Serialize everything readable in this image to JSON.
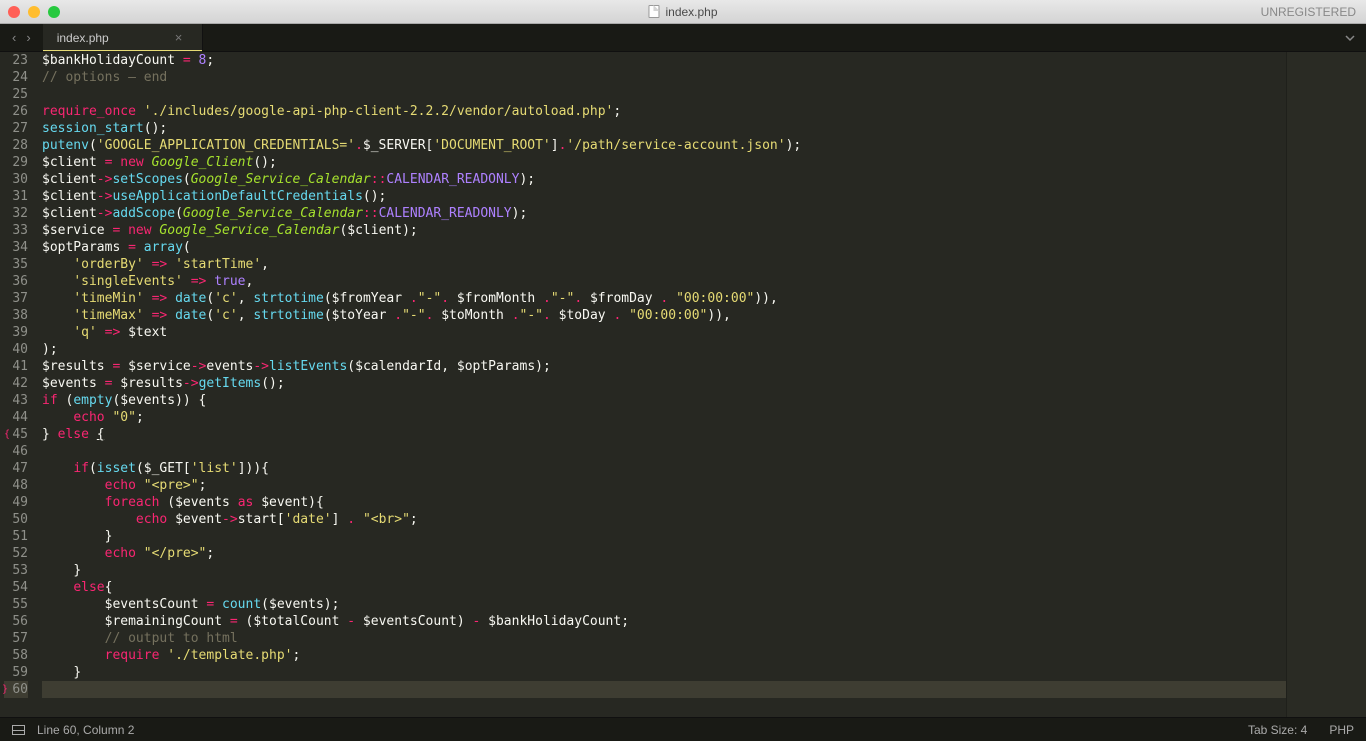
{
  "window": {
    "title": "index.php",
    "registration": "UNREGISTERED"
  },
  "tabs": {
    "active": "index.php"
  },
  "status": {
    "cursor": "Line 60, Column 2",
    "tab_size": "Tab Size: 4",
    "syntax": "PHP"
  },
  "gutter": {
    "start": 23,
    "end": 60,
    "open_brace_at": 45,
    "close_brace_at": 60,
    "highlighted": 60
  },
  "code_lines": [
    {
      "n": 23,
      "html": "<span class='c-var'>$bankHolidayCount</span> <span class='c-op'>=</span> <span class='c-num'>8</span><span class='c-punct'>;</span>"
    },
    {
      "n": 24,
      "html": "<span class='c-comment'>// options – end</span>"
    },
    {
      "n": 25,
      "html": ""
    },
    {
      "n": 26,
      "html": "<span class='c-kw'>require_once</span> <span class='c-str'>'./includes/google-api-php-client-2.2.2/vendor/autoload.php'</span><span class='c-punct'>;</span>"
    },
    {
      "n": 27,
      "html": "<span class='c-call'>session_start</span><span class='c-punct'>();</span>"
    },
    {
      "n": 28,
      "html": "<span class='c-call'>putenv</span><span class='c-punct'>(</span><span class='c-str'>'GOOGLE_APPLICATION_CREDENTIALS='</span><span class='c-op'>.</span><span class='c-var'>$_SERVER</span><span class='c-punct'>[</span><span class='c-str'>'DOCUMENT_ROOT'</span><span class='c-punct'>]</span><span class='c-op'>.</span><span class='c-str'>'/path/service-account.json'</span><span class='c-punct'>);</span>"
    },
    {
      "n": 29,
      "html": "<span class='c-var'>$client</span> <span class='c-op'>=</span> <span class='c-op'>new</span> <span class='c-class'>Google_Client</span><span class='c-punct'>();</span>"
    },
    {
      "n": 30,
      "html": "<span class='c-var'>$client</span><span class='c-op'>-&gt;</span><span class='c-call'>setScopes</span><span class='c-punct'>(</span><span class='c-class'>Google_Service_Calendar</span><span class='c-op'>::</span><span class='c-constkey'>CALENDAR_READONLY</span><span class='c-punct'>);</span>"
    },
    {
      "n": 31,
      "html": "<span class='c-var'>$client</span><span class='c-op'>-&gt;</span><span class='c-call'>useApplicationDefaultCredentials</span><span class='c-punct'>();</span>"
    },
    {
      "n": 32,
      "html": "<span class='c-var'>$client</span><span class='c-op'>-&gt;</span><span class='c-call'>addScope</span><span class='c-punct'>(</span><span class='c-class'>Google_Service_Calendar</span><span class='c-op'>::</span><span class='c-constkey'>CALENDAR_READONLY</span><span class='c-punct'>);</span>"
    },
    {
      "n": 33,
      "html": "<span class='c-var'>$service</span> <span class='c-op'>=</span> <span class='c-op'>new</span> <span class='c-class'>Google_Service_Calendar</span><span class='c-punct'>(</span><span class='c-var'>$client</span><span class='c-punct'>);</span>"
    },
    {
      "n": 34,
      "html": "<span class='c-var'>$optParams</span> <span class='c-op'>=</span> <span class='c-builtin'>array</span><span class='c-punct'>(</span>"
    },
    {
      "n": 35,
      "html": "    <span class='c-str'>'orderBy'</span> <span class='c-op'>=&gt;</span> <span class='c-str'>'startTime'</span><span class='c-punct'>,</span>"
    },
    {
      "n": 36,
      "html": "    <span class='c-str'>'singleEvents'</span> <span class='c-op'>=&gt;</span> <span class='c-const'>true</span><span class='c-punct'>,</span>"
    },
    {
      "n": 37,
      "html": "    <span class='c-str'>'timeMin'</span> <span class='c-op'>=&gt;</span> <span class='c-call'>date</span><span class='c-punct'>(</span><span class='c-str'>'c'</span><span class='c-punct'>,</span> <span class='c-call'>strtotime</span><span class='c-punct'>(</span><span class='c-var'>$fromYear</span> <span class='c-op'>.</span><span class='c-str'>\"-\"</span><span class='c-op'>.</span> <span class='c-var'>$fromMonth</span> <span class='c-op'>.</span><span class='c-str'>\"-\"</span><span class='c-op'>.</span> <span class='c-var'>$fromDay</span> <span class='c-op'>.</span> <span class='c-str'>\"00:00:00\"</span><span class='c-punct'>)),</span>"
    },
    {
      "n": 38,
      "html": "    <span class='c-str'>'timeMax'</span> <span class='c-op'>=&gt;</span> <span class='c-call'>date</span><span class='c-punct'>(</span><span class='c-str'>'c'</span><span class='c-punct'>,</span> <span class='c-call'>strtotime</span><span class='c-punct'>(</span><span class='c-var'>$toYear</span> <span class='c-op'>.</span><span class='c-str'>\"-\"</span><span class='c-op'>.</span> <span class='c-var'>$toMonth</span> <span class='c-op'>.</span><span class='c-str'>\"-\"</span><span class='c-op'>.</span> <span class='c-var'>$toDay</span> <span class='c-op'>.</span> <span class='c-str'>\"00:00:00\"</span><span class='c-punct'>)),</span>"
    },
    {
      "n": 39,
      "html": "    <span class='c-str'>'q'</span> <span class='c-op'>=&gt;</span> <span class='c-var'>$text</span>"
    },
    {
      "n": 40,
      "html": "<span class='c-punct'>);</span>"
    },
    {
      "n": 41,
      "html": "<span class='c-var'>$results</span> <span class='c-op'>=</span> <span class='c-var'>$service</span><span class='c-op'>-&gt;</span><span class='c-var'>events</span><span class='c-op'>-&gt;</span><span class='c-call'>listEvents</span><span class='c-punct'>(</span><span class='c-var'>$calendarId</span><span class='c-punct'>,</span> <span class='c-var'>$optParams</span><span class='c-punct'>);</span>"
    },
    {
      "n": 42,
      "html": "<span class='c-var'>$events</span> <span class='c-op'>=</span> <span class='c-var'>$results</span><span class='c-op'>-&gt;</span><span class='c-call'>getItems</span><span class='c-punct'>();</span>"
    },
    {
      "n": 43,
      "html": "<span class='c-kw'>if</span> <span class='c-punct'>(</span><span class='c-builtin'>empty</span><span class='c-punct'>(</span><span class='c-var'>$events</span><span class='c-punct'>)) {</span>"
    },
    {
      "n": 44,
      "html": "    <span class='c-kw'>echo</span> <span class='c-str'>\"0\"</span><span class='c-punct'>;</span>"
    },
    {
      "n": 45,
      "html": "<span class='c-punct'>}</span> <span class='c-kw'>else</span> <span class='c-punct' style='text-decoration:underline'>{</span>"
    },
    {
      "n": 46,
      "html": ""
    },
    {
      "n": 47,
      "html": "    <span class='c-kw'>if</span><span class='c-punct'>(</span><span class='c-builtin'>isset</span><span class='c-punct'>(</span><span class='c-var'>$_GET</span><span class='c-punct'>[</span><span class='c-str'>'list'</span><span class='c-punct'>])){</span>"
    },
    {
      "n": 48,
      "html": "        <span class='c-kw'>echo</span> <span class='c-str'>\"&lt;pre&gt;\"</span><span class='c-punct'>;</span>"
    },
    {
      "n": 49,
      "html": "        <span class='c-kw'>foreach</span> <span class='c-punct'>(</span><span class='c-var'>$events</span> <span class='c-kw'>as</span> <span class='c-var'>$event</span><span class='c-punct'>){</span>"
    },
    {
      "n": 50,
      "html": "            <span class='c-kw'>echo</span> <span class='c-var'>$event</span><span class='c-op'>-&gt;</span><span class='c-var'>start</span><span class='c-punct'>[</span><span class='c-str'>'date'</span><span class='c-punct'>]</span> <span class='c-op'>.</span> <span class='c-str'>\"&lt;br&gt;\"</span><span class='c-punct'>;</span>"
    },
    {
      "n": 51,
      "html": "        <span class='c-punct'>}</span>"
    },
    {
      "n": 52,
      "html": "        <span class='c-kw'>echo</span> <span class='c-str'>\"&lt;/pre&gt;\"</span><span class='c-punct'>;</span>"
    },
    {
      "n": 53,
      "html": "    <span class='c-punct'>}</span>"
    },
    {
      "n": 54,
      "html": "    <span class='c-kw'>else</span><span class='c-punct'>{</span>"
    },
    {
      "n": 55,
      "html": "        <span class='c-var'>$eventsCount</span> <span class='c-op'>=</span> <span class='c-builtin'>count</span><span class='c-punct'>(</span><span class='c-var'>$events</span><span class='c-punct'>);</span>"
    },
    {
      "n": 56,
      "html": "        <span class='c-var'>$remainingCount</span> <span class='c-op'>=</span> <span class='c-punct'>(</span><span class='c-var'>$totalCount</span> <span class='c-op'>-</span> <span class='c-var'>$eventsCount</span><span class='c-punct'>)</span> <span class='c-op'>-</span> <span class='c-var'>$bankHolidayCount</span><span class='c-punct'>;</span>"
    },
    {
      "n": 57,
      "html": "        <span class='c-comment'>// output to html</span>"
    },
    {
      "n": 58,
      "html": "        <span class='c-kw'>require</span> <span class='c-str'>'./template.php'</span><span class='c-punct'>;</span>"
    },
    {
      "n": 59,
      "html": "    <span class='c-punct'>}</span>"
    },
    {
      "n": 60,
      "html": "",
      "hl": true
    }
  ]
}
